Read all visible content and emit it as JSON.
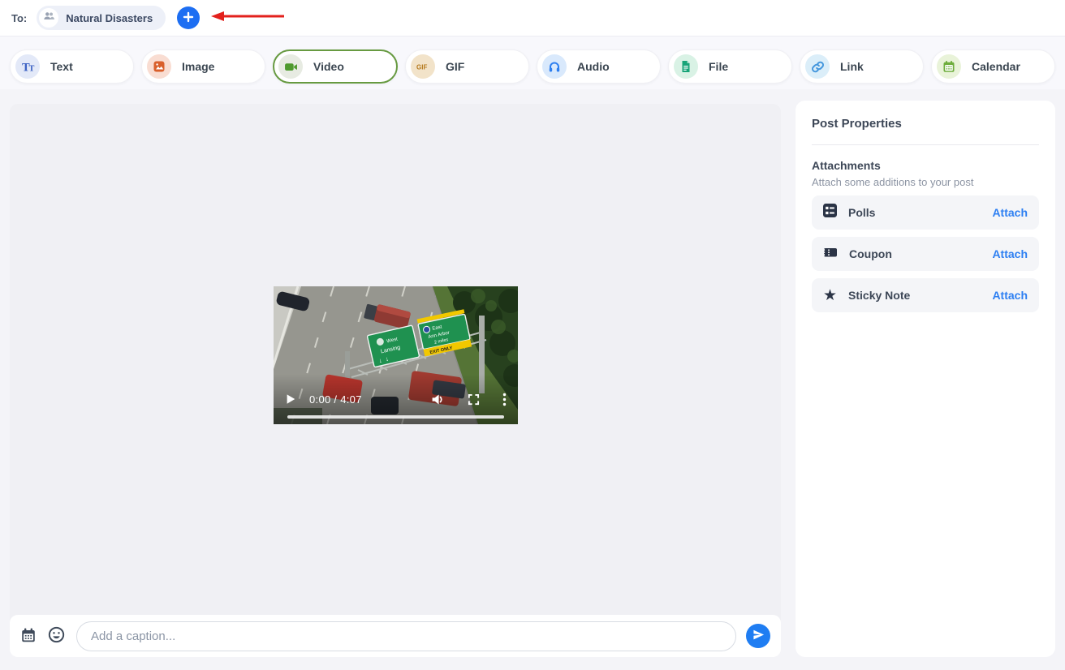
{
  "colors": {
    "accent_blue": "#1d6ef2",
    "selected_tab_green": "#679a41",
    "attach_link_blue": "#2d7ff2",
    "annotation_red": "#e3211c",
    "canvas_gray": "#f0f0f4"
  },
  "recipient_bar": {
    "to_label": "To:",
    "chip": {
      "label": "Natural Disasters",
      "avatar_icon": "group-icon"
    },
    "add_button_icon": "plus-icon",
    "annotation": "red-arrow-pointing-left-at-add-button"
  },
  "tabs": [
    {
      "label": "Text",
      "icon": "text-icon",
      "selected": false
    },
    {
      "label": "Image",
      "icon": "image-icon",
      "selected": false
    },
    {
      "label": "Video",
      "icon": "video-camera-icon",
      "selected": true
    },
    {
      "label": "GIF",
      "icon": "gif-icon",
      "selected": false
    },
    {
      "label": "Audio",
      "icon": "headphones-icon",
      "selected": false
    },
    {
      "label": "File",
      "icon": "file-icon",
      "selected": false
    },
    {
      "label": "Link",
      "icon": "link-icon",
      "selected": false
    },
    {
      "label": "Calendar",
      "icon": "calendar-icon",
      "selected": false
    }
  ],
  "video_player": {
    "time_display": "0:00 / 4:07",
    "progress_percent": 0,
    "controls": [
      "play",
      "volume",
      "fullscreen",
      "more"
    ],
    "scene": {
      "description": "aerial view of highway with collapsed overhead sign gantry, dump truck and trees",
      "sign_left_line1": "West",
      "sign_left_line2": "Lansing",
      "sign_right_line1": "East",
      "sign_right_line2": "Ann Arbor",
      "sign_right_line3": "2 miles",
      "sign_right_exit": "EXIT ONLY"
    }
  },
  "sidebar": {
    "title": "Post Properties",
    "attachments": {
      "heading": "Attachments",
      "subtitle": "Attach some additions to your post",
      "items": [
        {
          "label": "Polls",
          "icon": "poll-icon",
          "action": "Attach"
        },
        {
          "label": "Coupon",
          "icon": "coupon-icon",
          "action": "Attach"
        },
        {
          "label": "Sticky Note",
          "icon": "star-icon",
          "action": "Attach"
        }
      ]
    }
  },
  "composer": {
    "caption_placeholder": "Add a caption...",
    "schedule_icon": "calendar-icon",
    "emoji_icon": "emoji-smile-icon",
    "send_icon": "send-paper-plane-icon"
  }
}
